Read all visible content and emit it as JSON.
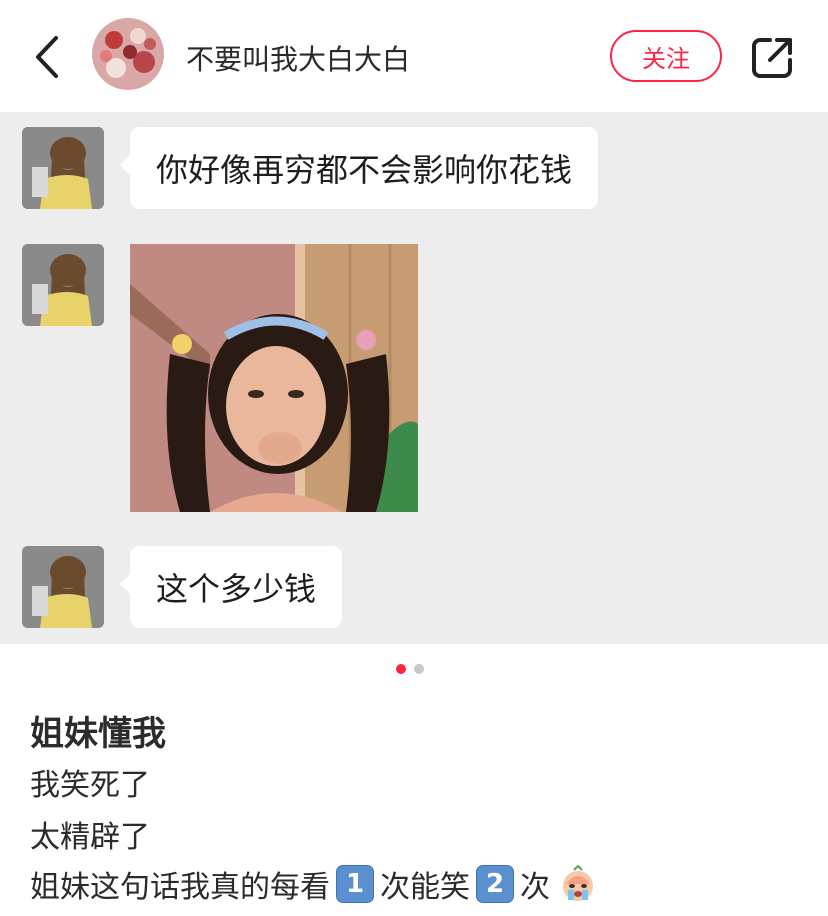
{
  "header": {
    "username": "不要叫我大白大白",
    "follow_label": "关注"
  },
  "chat": {
    "messages": [
      {
        "type": "text",
        "text": "你好像再穷都不会影响你花钱"
      },
      {
        "type": "image"
      },
      {
        "type": "text",
        "text": "这个多少钱"
      }
    ]
  },
  "pagination": {
    "current": 1,
    "total": 2,
    "active_color": "#ff2442",
    "inactive_color": "#c8c8c8"
  },
  "post": {
    "title": "姐妹懂我",
    "lines": [
      "我笑死了",
      "太精辟了"
    ],
    "last_line": {
      "part1": "姐妹这句话我真的每看",
      "num1": "1",
      "part2": "次能笑",
      "num2": "2",
      "part3": "次"
    }
  },
  "icons": {
    "back": "chevron-left-icon",
    "share": "share-icon",
    "emoji": "crying-emoji-icon"
  },
  "colors": {
    "accent": "#ff2442",
    "chat_bg": "#ededed"
  }
}
